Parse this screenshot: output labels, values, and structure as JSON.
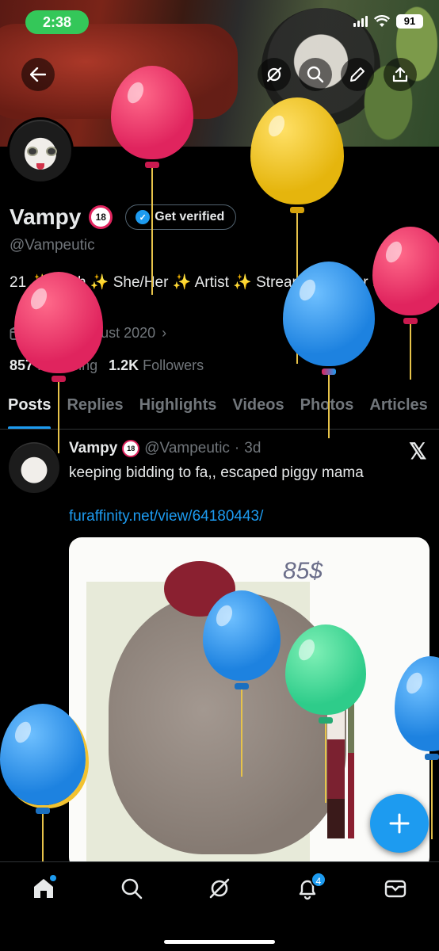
{
  "status_bar": {
    "time": "2:38",
    "battery": "91"
  },
  "profile": {
    "name": "Vampy",
    "name_badge": "18",
    "get_verified_label": "Get verified",
    "handle": "@Vampeutic",
    "bio": "21 ✨ Goth ✨ She/Her ✨ Artist ✨ Streamer/Gamer ✨",
    "joined": "Joined August 2020",
    "following_count": "857",
    "following_label": "Following",
    "followers_count": "1.2K",
    "followers_label": "Followers"
  },
  "tabs": [
    "Posts",
    "Replies",
    "Highlights",
    "Videos",
    "Photos",
    "Articles"
  ],
  "post": {
    "name": "Vampy",
    "badge": "18",
    "handle": "@Vampeutic",
    "sep": "·",
    "time": "3d",
    "text": "keeping bidding to fa,, escaped piggy mama",
    "link": "furaffinity.net/view/64180443/",
    "media_price": "85$"
  },
  "nav": {
    "notifications_count": "4"
  },
  "colors": {
    "accent": "#1d9bf0",
    "background": "#000000",
    "muted": "#71767b",
    "text": "#e7e9ea"
  }
}
